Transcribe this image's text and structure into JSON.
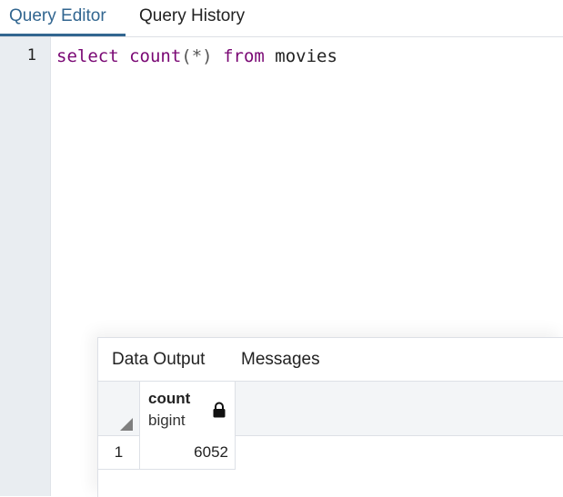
{
  "tabs": [
    {
      "label": "Query Editor",
      "active": true
    },
    {
      "label": "Query History",
      "active": false
    }
  ],
  "editor": {
    "line_number": "1",
    "code": {
      "keyword_select": "select",
      "function_count": "count",
      "args": "(*)",
      "keyword_from": "from",
      "table": "movies"
    }
  },
  "result": {
    "tabs": [
      {
        "label": "Data Output",
        "active": true
      },
      {
        "label": "Messages",
        "active": false
      }
    ],
    "columns": [
      {
        "name": "count",
        "type": "bigint",
        "icon": "lock-icon"
      }
    ],
    "rows": [
      {
        "row_number": "1",
        "values": [
          "6052"
        ]
      }
    ]
  },
  "colors": {
    "accent": "#326690",
    "keyword": "#7a0874",
    "gutter": "#e9edf1"
  }
}
